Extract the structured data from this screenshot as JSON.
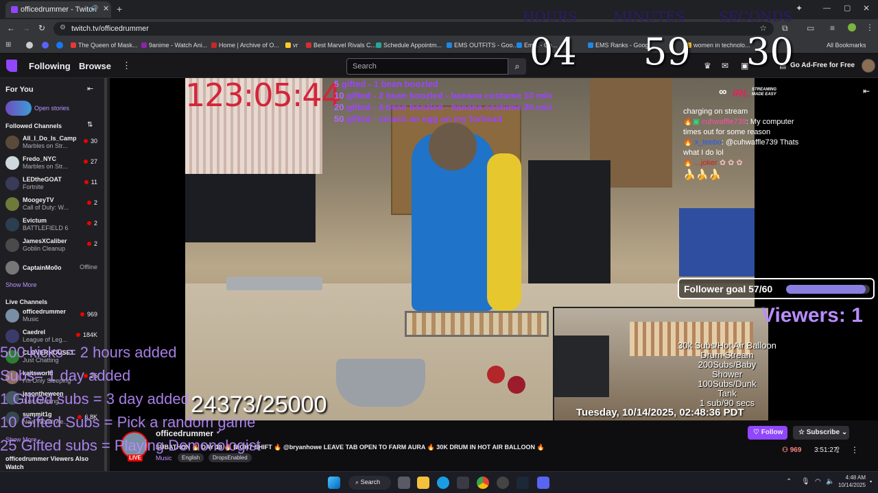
{
  "browser": {
    "tab_title": "officedrummer - Twitch",
    "url": "twitch.tv/officedrummer",
    "bookmarks": [
      {
        "label": "The Queen of Mask...",
        "color": "#e53935"
      },
      {
        "label": "9anime - Watch Ani...",
        "color": "#8e24aa"
      },
      {
        "label": "Home | Archive of O...",
        "color": "#c62828"
      },
      {
        "label": "vr",
        "color": "#ffca28"
      },
      {
        "label": "Best Marvel Rivals C...",
        "color": "#d32f2f"
      },
      {
        "label": "Schedule Appointm...",
        "color": "#26a69a"
      },
      {
        "label": "EMS OUTFITS - Goo...",
        "color": "#1e88e5"
      },
      {
        "label": "Em... - Go...",
        "color": "#1e88e5"
      },
      {
        "label": "EMS Ranks - Googl...",
        "color": "#1e88e5"
      },
      {
        "label": "women in technolo...",
        "color": "#fbc02d"
      }
    ],
    "all_bookmarks": "All Bookmarks"
  },
  "topnav": {
    "following": "Following",
    "browse": "Browse",
    "search_placeholder": "Search",
    "ad_free": "Go Ad-Free for Free"
  },
  "sidebar": {
    "for_you": "For You",
    "open_stories": "Open stories",
    "followed_header": "Followed Channels",
    "followed": [
      {
        "name": "All_I_Do_Is_Camp",
        "game": "Marbles on Str...",
        "viewers": "30",
        "avatar": "#5a4a3a"
      },
      {
        "name": "Fredo_NYC",
        "game": "Marbles on Str...",
        "viewers": "27",
        "avatar": "#cfd8dc"
      },
      {
        "name": "LEDtheGOAT",
        "game": "Fortnite",
        "viewers": "11",
        "avatar": "#3a3a5a"
      },
      {
        "name": "MoogeyTV",
        "game": "Call of Duty: W...",
        "viewers": "2",
        "avatar": "#6d7a3a"
      },
      {
        "name": "Evictum",
        "game": "BATTLEFIELD 6",
        "viewers": "2",
        "avatar": "#2c3e50"
      },
      {
        "name": "JamesXCaliber",
        "game": "Goblin Cleanup",
        "viewers": "2",
        "avatar": "#4a4a4a"
      }
    ],
    "offline_channel": {
      "name": "CaptainMo0o",
      "status": "Offline"
    },
    "show_more": "Show More",
    "live_header": "Live Channels",
    "live": [
      {
        "name": "officedrummer",
        "game": "Music",
        "viewers": "969",
        "avatar": "#7a8fa6"
      },
      {
        "name": "Caedrel",
        "game": "League of Leg...",
        "viewers": "184K",
        "avatar": "#3b3b6b"
      },
      {
        "name": "CLOVERHOUSE1",
        "game": "Just Chatting",
        "viewers": "",
        "avatar": "#2e7d32"
      },
      {
        "name": "kaitsworld",
        "game": "I'm Only Sleeping",
        "viewers": "25",
        "avatar": "#8d6e63"
      },
      {
        "name": "jasontheween",
        "game": "Just Chatting",
        "viewers": "",
        "avatar": "#455a64"
      },
      {
        "name": "summit1g",
        "game": "New World: Ae...",
        "viewers": "6.8K",
        "avatar": "#37474f"
      }
    ],
    "show_more_2": "Show More",
    "viewers_also_watch": "officedrummer Viewers Also Watch"
  },
  "overlay": {
    "uptime": "123:05:44",
    "gift_rules": [
      {
        "count": "5",
        "text": "gifted - 1 bean boozled"
      },
      {
        "count": "10",
        "text": "gifted - 2 bean boozled - banana costume 10 min"
      },
      {
        "count": "20",
        "text": "gifted - 4 bean boozled - banana costume 20 min"
      },
      {
        "count": "50",
        "text": "gifted - smash an egg on my forhead"
      }
    ],
    "timer_labels": [
      "HOURS",
      "MINUTES",
      "SECONDS"
    ],
    "timer_values": [
      "04",
      "59",
      "30"
    ],
    "irl_logo": "IRL",
    "irl_tagline": "STREAMING MADE EASY",
    "chat": [
      {
        "user": "",
        "text": "charging on stream",
        "color": "#ffffff"
      },
      {
        "user": "cuhwaffle739",
        "text": "My computer times out for some reason",
        "color": "#ff4fa8"
      },
      {
        "user": "x_teebo",
        "text": "@cuhwaffle739 Thats what I do lol",
        "color": "#1e5bff"
      },
      {
        "user": "...joker",
        "text": "",
        "color": "#d11f1f"
      }
    ],
    "follower_goal": "Follower goal 57/60",
    "follower_goal_fraction": 0.95,
    "viewers_label": "Viewers: 1",
    "sub_goals": [
      "30k Subs/Hot Air Balloon",
      "Drum Stream",
      "200Subs/Baby",
      "Shower",
      "100Subs/Dunk",
      "Tank",
      "1 sub/90 secs"
    ],
    "kicks_rules": [
      "500 kicks = 2 hours added",
      "Subs= 1 day added",
      "1 Gifted subs = 3 day added",
      "10 Gifted Subs = Pick a random game",
      "25 Gifted subs = Playing Demonologist"
    ],
    "sub_counter": "24373/25000",
    "datetime": "Tuesday, 10/14/2025, 02:48:36 PDT"
  },
  "stream_info": {
    "channel": "officedrummer",
    "title": "SUBATHON 🔥 DAY 18 🔥 NIGHT SHIFT 🔥 @bryanhowe LEAVE TAB OPEN TO FARM AURA 🔥 30K DRUM IN HOT AIR BALLOON 🔥",
    "mention": "@bryanhowe",
    "category": "Music",
    "tags": [
      "English",
      "DropsEnabled"
    ],
    "live_badge": "LIVE",
    "follow": "Follow",
    "subscribe": "Subscribe",
    "viewer_count": "969",
    "uptime": "3:51:27"
  },
  "taskbar": {
    "search": "Search",
    "time": "4:48 AM",
    "date": "10/14/2025"
  },
  "colors": {
    "twitch_purple": "#9146ff",
    "overlay_purple": "#b98cff",
    "live_red": "#eb0400"
  }
}
